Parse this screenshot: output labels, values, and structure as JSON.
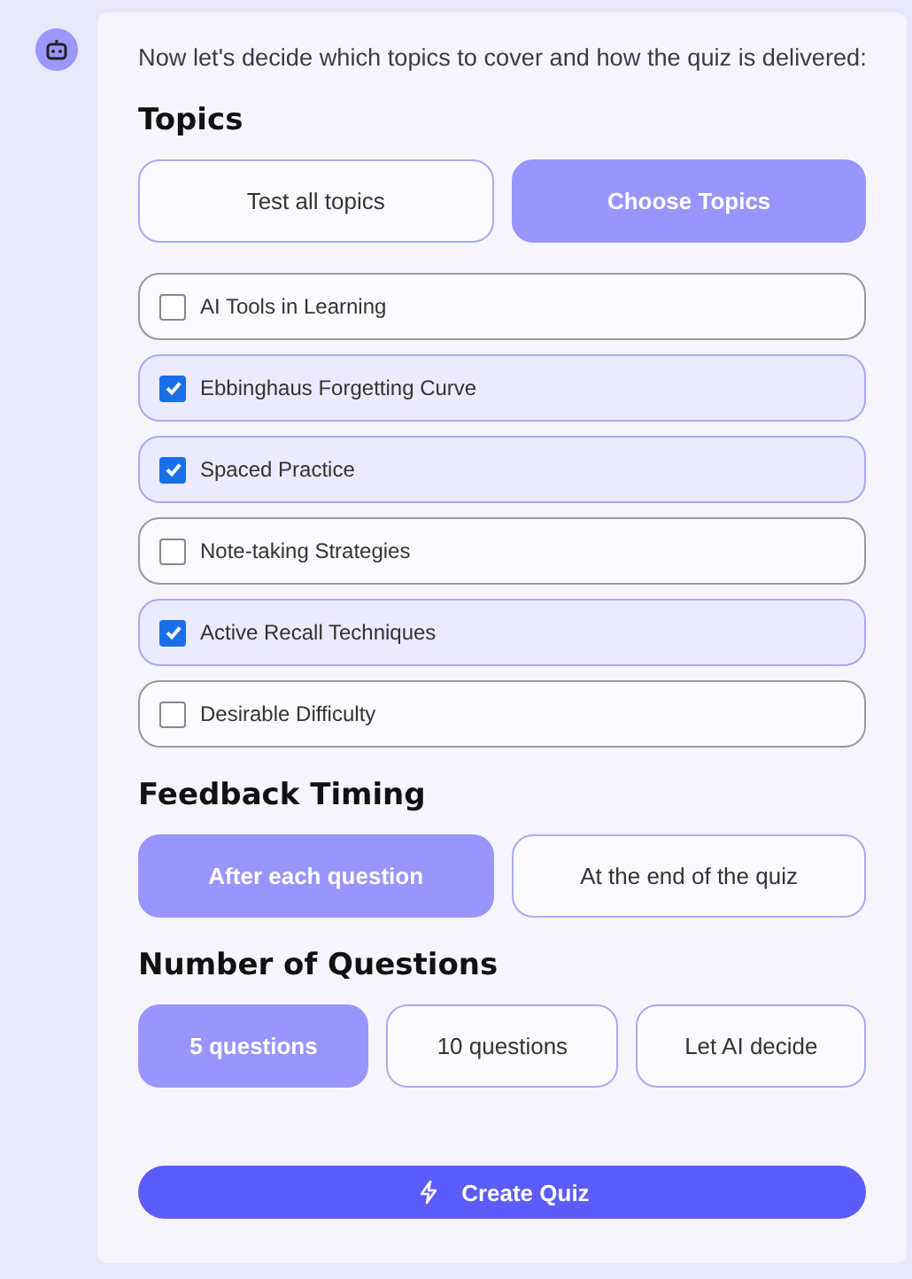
{
  "intro": "Now let's decide which topics to cover and how the quiz is delivered:",
  "topics": {
    "heading": "Topics",
    "modes": [
      {
        "label": "Test all topics",
        "selected": false
      },
      {
        "label": "Choose Topics",
        "selected": true
      }
    ],
    "items": [
      {
        "label": "AI Tools in Learning",
        "checked": false
      },
      {
        "label": "Ebbinghaus Forgetting Curve",
        "checked": true
      },
      {
        "label": "Spaced Practice",
        "checked": true
      },
      {
        "label": "Note-taking Strategies",
        "checked": false
      },
      {
        "label": "Active Recall Techniques",
        "checked": true
      },
      {
        "label": "Desirable Difficulty",
        "checked": false
      }
    ]
  },
  "feedback": {
    "heading": "Feedback Timing",
    "options": [
      {
        "label": "After each question",
        "selected": true
      },
      {
        "label": "At the end of the quiz",
        "selected": false
      }
    ]
  },
  "questions": {
    "heading": "Number of Questions",
    "options": [
      {
        "label": "5 questions",
        "selected": true
      },
      {
        "label": "10 questions",
        "selected": false
      },
      {
        "label": "Let AI decide",
        "selected": false
      }
    ]
  },
  "create_button": "Create Quiz"
}
